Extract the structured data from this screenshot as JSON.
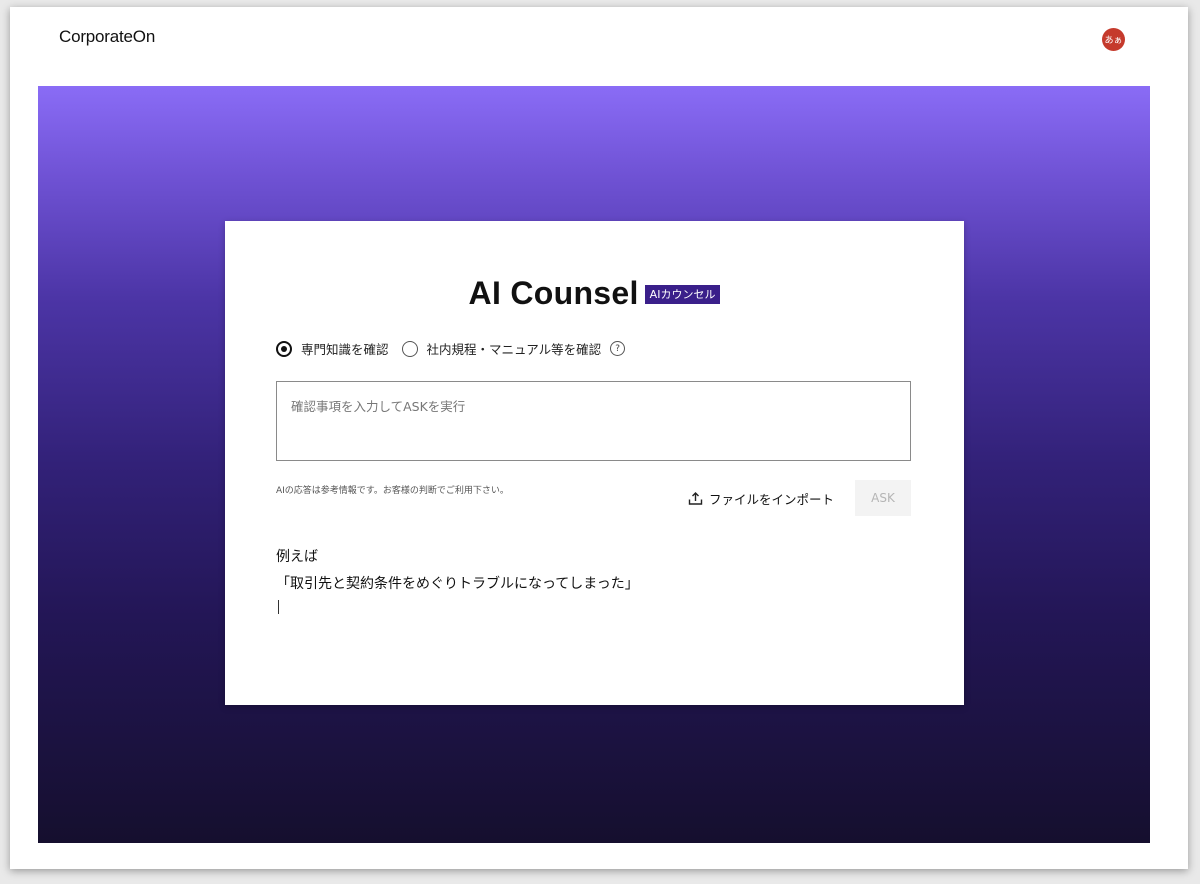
{
  "app": {
    "logo": "CorporateOn",
    "user_avatar": "あぁ"
  },
  "colors": {
    "accent": "#3a1f8a",
    "avatar": "#c53a2c",
    "gradient_top": "#8a6cf6",
    "gradient_bottom": "#150f2e"
  },
  "card": {
    "title": "AI Counsel",
    "badge": "AIカウンセル",
    "modes": [
      {
        "label": "専門知識を確認",
        "selected": true
      },
      {
        "label": "社内規程・マニュアル等を確認",
        "selected": false
      }
    ],
    "help_icon": "question-circle-icon",
    "query_placeholder": "確認事項を入力してASKを実行",
    "disclaimer": "AIの応答は参考情報です。お客様の判断でご利用下さい。",
    "import_label": "ファイルをインポート",
    "import_icon": "upload-icon",
    "ask_label": "ASK",
    "example_heading": "例えば",
    "example_text": "「取引先と契約条件をめぐりトラブルになってしまった」"
  }
}
